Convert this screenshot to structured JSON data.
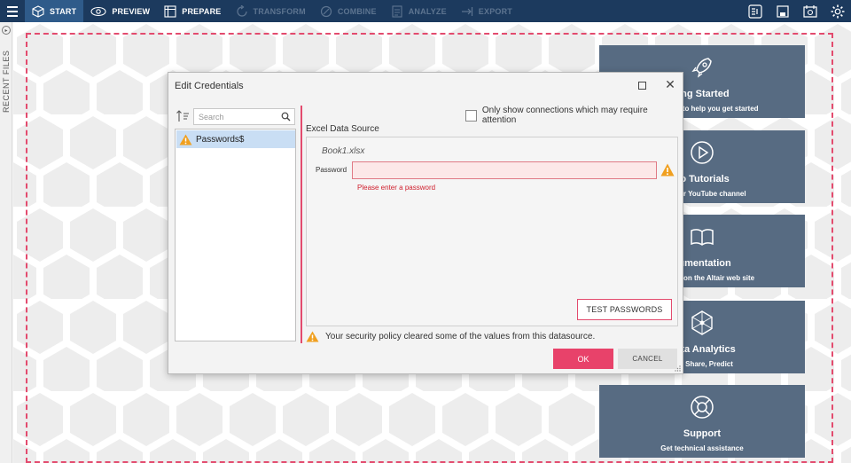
{
  "toolbar": {
    "tabs": [
      {
        "label": "START",
        "icon": "cube-icon",
        "state": "active"
      },
      {
        "label": "PREVIEW",
        "icon": "eye-icon",
        "state": "normal"
      },
      {
        "label": "PREPARE",
        "icon": "table-icon",
        "state": "normal"
      },
      {
        "label": "TRANSFORM",
        "icon": "refresh-icon",
        "state": "disabled"
      },
      {
        "label": "COMBINE",
        "icon": "combine-icon",
        "state": "disabled"
      },
      {
        "label": "ANALYZE",
        "icon": "analyze-icon",
        "state": "disabled"
      },
      {
        "label": "EXPORT",
        "icon": "export-icon",
        "state": "disabled"
      }
    ],
    "right_icons": [
      "document-list-icon",
      "save-icon",
      "workspace-icon",
      "settings-gear-icon"
    ]
  },
  "left_rail": {
    "label": "RECENT FILES"
  },
  "tiles": [
    {
      "title": "ting Started",
      "subtitle": "s machine to help you get started",
      "icon": "rocket-icon"
    },
    {
      "title": "eo Tutorials",
      "subtitle": "s on our YouTube channel",
      "icon": "play-icon"
    },
    {
      "title": "cumentation",
      "subtitle": "d Tutorial on the Altair web site",
      "icon": "book-icon"
    },
    {
      "title": "Data Analytics",
      "subtitle": "ate, Share, Predict",
      "icon": "network-icon"
    },
    {
      "title": "Support",
      "subtitle": "Get technical assistance",
      "icon": "lifebuoy-icon"
    }
  ],
  "dialog": {
    "title": "Edit Credentials",
    "search_placeholder": "Search",
    "sources": [
      {
        "label": "Passwords$",
        "status": "warning"
      }
    ],
    "only_show_label": "Only show connections which may require attention",
    "section_label": "Excel Data Source",
    "file_name": "Book1.xlsx",
    "password_label": "Password",
    "password_value": "",
    "password_error": "Please enter a password",
    "test_button": "TEST PASSWORDS",
    "policy_message": "Your security policy cleared some of the values from this datasource.",
    "ok_button": "OK",
    "cancel_button": "CANCEL"
  },
  "colors": {
    "toolbar_bg": "#1c3a5e",
    "active_tab": "#2f5b8a",
    "accent": "#e34b6e",
    "ok_button": "#e8426a",
    "tile_bg": "#576b82",
    "warning": "#f0a020",
    "selection": "#c9def4"
  }
}
